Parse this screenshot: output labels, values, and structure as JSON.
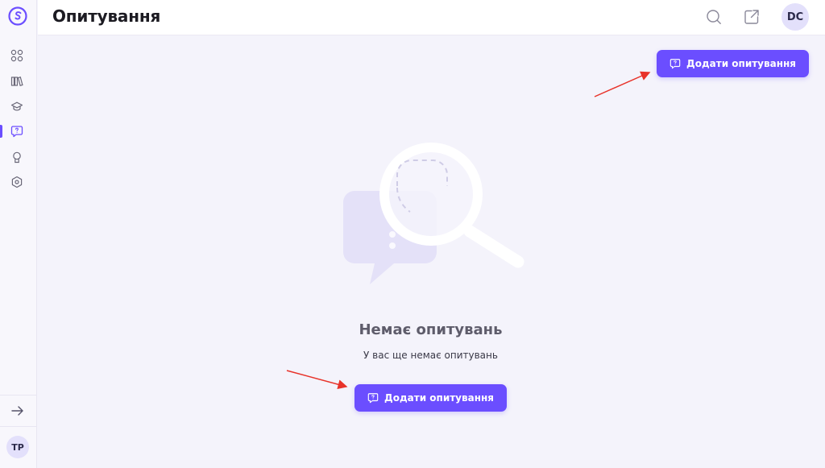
{
  "header": {
    "title": "Опитування",
    "user_initials": "DC",
    "icons": [
      "search-icon",
      "external-link-icon"
    ]
  },
  "sidebar": {
    "items": [
      {
        "icon": "dashboard-icon",
        "active": false
      },
      {
        "icon": "library-icon",
        "active": false
      },
      {
        "icon": "graduation-cap-icon",
        "active": false
      },
      {
        "icon": "survey-icon",
        "active": true
      },
      {
        "icon": "award-icon",
        "active": false
      },
      {
        "icon": "settings-icon",
        "active": false
      }
    ],
    "collapse_icon": "arrow-right-icon",
    "user_initials": "TP"
  },
  "toolbar": {
    "add_survey_label": "Додати опитування"
  },
  "empty_state": {
    "title": "Немає опитувань",
    "subtitle": "У вас ще немає опитувань",
    "button_label": "Додати опитування"
  },
  "colors": {
    "accent": "#6b4eff",
    "background": "#f4f3fb",
    "annotation_arrow": "#e8332a"
  }
}
